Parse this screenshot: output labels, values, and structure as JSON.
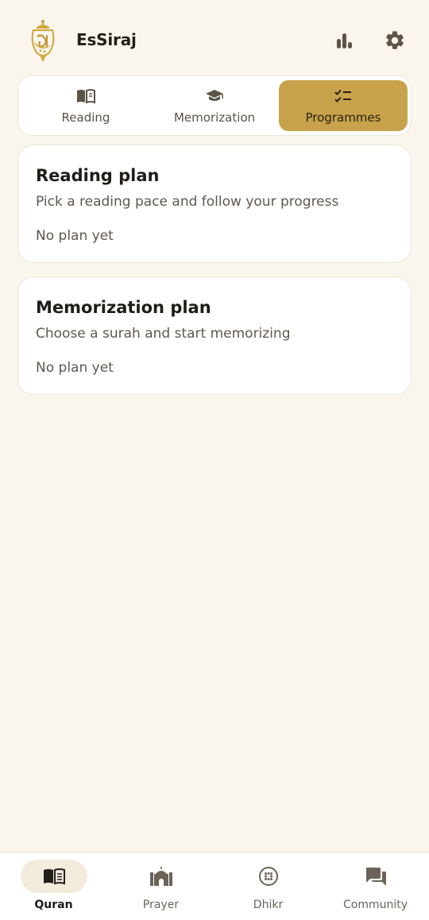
{
  "app": {
    "title": "EsSiraj"
  },
  "header": {
    "icons": [
      "logo-lantern",
      "stats-icon",
      "gear-icon"
    ]
  },
  "tabs": [
    {
      "label": "Reading",
      "icon": "book-open-icon",
      "selected": false
    },
    {
      "label": "Memorization",
      "icon": "graduation-cap-icon",
      "selected": false
    },
    {
      "label": "Programmes",
      "icon": "checklist-icon",
      "selected": true
    }
  ],
  "cards": [
    {
      "title": "Reading plan",
      "subtitle": "Pick a reading pace and follow your progress",
      "status": "No plan yet"
    },
    {
      "title": "Memorization plan",
      "subtitle": "Choose a surah and start memorizing",
      "status": "No plan yet"
    }
  ],
  "bottom_nav": [
    {
      "label": "Quran",
      "icon": "quran-book-icon",
      "active": true
    },
    {
      "label": "Prayer",
      "icon": "mosque-icon",
      "active": false
    },
    {
      "label": "Dhikr",
      "icon": "prayer-beads-icon",
      "active": false
    },
    {
      "label": "Community",
      "icon": "chat-bubbles-icon",
      "active": false
    }
  ],
  "colors": {
    "background": "#faf6ee",
    "accent": "#c8a24a",
    "card": "#ffffff",
    "icon": "#5c5446"
  }
}
